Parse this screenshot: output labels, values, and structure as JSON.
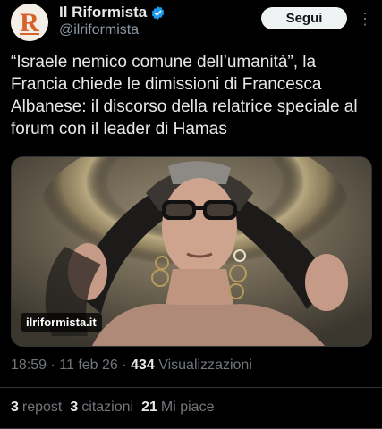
{
  "account": {
    "display_name": "Il Riformista",
    "handle": "@ilriformista",
    "avatar_letter": "R"
  },
  "follow_label": "Segui",
  "more_icon": "⋮",
  "tweet": {
    "text": "“Israele nemico comune dell’umanità”, la Francia chiede le dimissioni di Francesca Albanese: il discorso della relatrice speciale al forum con il leader di Hamas"
  },
  "media": {
    "source_label": "ilriformista.it"
  },
  "meta": {
    "time": "18:59",
    "separator": "·",
    "date": "11 feb 26",
    "views_count": "434",
    "views_label": "Visualizzazioni"
  },
  "stats": {
    "reposts_count": "3",
    "reposts_label": "repost",
    "quotes_count": "3",
    "quotes_label": "citazioni",
    "likes_count": "21",
    "likes_label": "Mi piace"
  },
  "colors": {
    "background": "#000000",
    "text": "#e7e9ea",
    "secondary": "#71767b",
    "verified": "#1d9bf0",
    "brand": "#d9622b"
  }
}
